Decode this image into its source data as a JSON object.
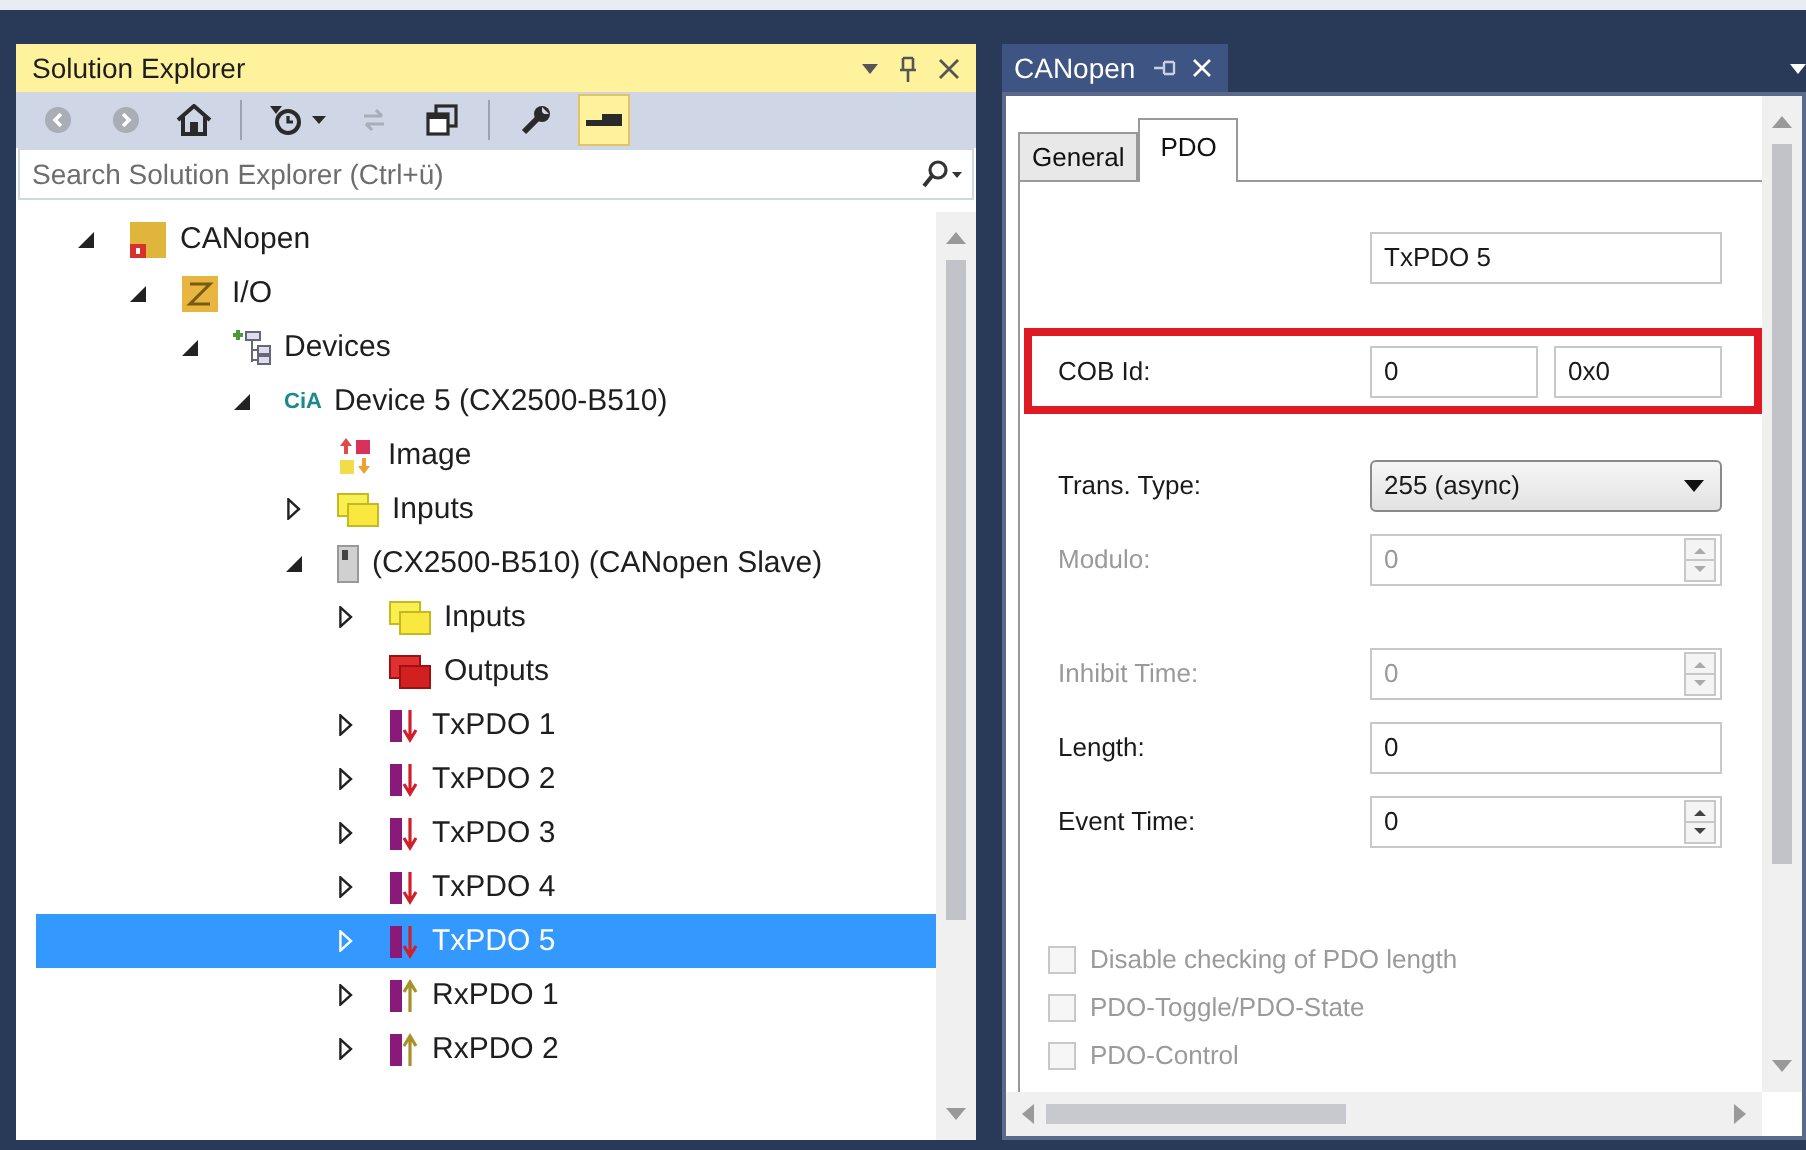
{
  "explorer": {
    "title": "Solution Explorer",
    "toolbar": [
      {
        "buttons": [
          {
            "kind": "back",
            "disabled": true,
            "on": false
          },
          {
            "kind": "forward",
            "disabled": true,
            "on": false
          },
          {
            "kind": "home",
            "disabled": false,
            "on": false
          }
        ]
      },
      {
        "buttons": [
          {
            "kind": "history",
            "disabled": false,
            "on": false
          },
          {
            "kind": "sync",
            "disabled": true,
            "on": false
          },
          {
            "kind": "windows",
            "disabled": false,
            "on": false
          }
        ]
      },
      {
        "buttons": [
          {
            "kind": "properties",
            "disabled": false,
            "on": false
          },
          {
            "kind": "preview",
            "disabled": false,
            "on": true
          }
        ]
      }
    ],
    "search": {
      "placeholder": "Search Solution Explorer (Ctrl+ü)"
    },
    "tree": [
      {
        "label": "CANopen",
        "kind": "project",
        "expandable": true,
        "expanded": true,
        "selected": false,
        "children": [
          {
            "label": "I/O",
            "kind": "io",
            "expandable": true,
            "expanded": true,
            "selected": false,
            "children": [
              {
                "label": "Devices",
                "kind": "devices",
                "expandable": true,
                "expanded": true,
                "selected": false,
                "children": [
                  {
                    "label": "Device 5 (CX2500-B510)",
                    "kind": "cia",
                    "badge": "CiA",
                    "expandable": true,
                    "expanded": true,
                    "selected": false,
                    "children": [
                      {
                        "label": "Image",
                        "kind": "image",
                        "expandable": false,
                        "selected": false
                      },
                      {
                        "label": "Inputs",
                        "kind": "inputs",
                        "expandable": true,
                        "expanded": false,
                        "selected": false
                      },
                      {
                        "label": "(CX2500-B510) (CANopen Slave)",
                        "kind": "terminal",
                        "expandable": true,
                        "expanded": true,
                        "selected": false,
                        "children": [
                          {
                            "label": "Inputs",
                            "kind": "inputs",
                            "expandable": true,
                            "expanded": false,
                            "selected": false
                          },
                          {
                            "label": "Outputs",
                            "kind": "outputs",
                            "expandable": false,
                            "selected": false
                          },
                          {
                            "label": "TxPDO 1",
                            "kind": "txpdo",
                            "expandable": true,
                            "expanded": false,
                            "selected": false
                          },
                          {
                            "label": "TxPDO 2",
                            "kind": "txpdo",
                            "expandable": true,
                            "expanded": false,
                            "selected": false
                          },
                          {
                            "label": "TxPDO 3",
                            "kind": "txpdo",
                            "expandable": true,
                            "expanded": false,
                            "selected": false
                          },
                          {
                            "label": "TxPDO 4",
                            "kind": "txpdo",
                            "expandable": true,
                            "expanded": false,
                            "selected": false
                          },
                          {
                            "label": "TxPDO 5",
                            "kind": "txpdo",
                            "expandable": true,
                            "expanded": false,
                            "selected": true
                          },
                          {
                            "label": "RxPDO 1",
                            "kind": "rxpdo",
                            "expandable": true,
                            "expanded": false,
                            "selected": false
                          },
                          {
                            "label": "RxPDO 2",
                            "kind": "rxpdo",
                            "expandable": true,
                            "expanded": false,
                            "selected": false
                          }
                        ]
                      }
                    ]
                  }
                ]
              }
            ]
          }
        ]
      }
    ]
  },
  "editor": {
    "title": "CANopen",
    "tabs": [
      {
        "label": "General",
        "selected": false
      },
      {
        "label": "PDO",
        "selected": true
      }
    ],
    "groups": [
      {
        "highlighted": false,
        "fields": [
          {
            "kind": "text",
            "value": "TxPDO 5",
            "disabled": false
          }
        ]
      },
      {
        "highlighted": true,
        "fields": [
          {
            "kind": "pair",
            "label": "COB Id:",
            "values": [
              "0",
              "0x0"
            ],
            "disabled": false
          }
        ]
      },
      {
        "highlighted": false,
        "fields": [
          {
            "kind": "select",
            "label": "Trans. Type:",
            "value": "255 (async)",
            "disabled": false
          },
          {
            "kind": "spinner",
            "label": "Modulo:",
            "value": "0",
            "disabled": true
          }
        ]
      },
      {
        "highlighted": false,
        "fields": [
          {
            "kind": "spinner",
            "label": "Inhibit Time:",
            "value": "0",
            "disabled": true
          },
          {
            "kind": "text",
            "label": "Length:",
            "value": "0",
            "disabled": false
          },
          {
            "kind": "spinner",
            "label": "Event Time:",
            "value": "0",
            "disabled": false
          }
        ]
      }
    ],
    "checkboxes": [
      {
        "label": "Disable checking of PDO length",
        "checked": false,
        "disabled": true
      },
      {
        "label": "PDO-Toggle/PDO-State",
        "checked": false,
        "disabled": true
      },
      {
        "label": "PDO-Control",
        "checked": false,
        "disabled": true
      }
    ]
  }
}
